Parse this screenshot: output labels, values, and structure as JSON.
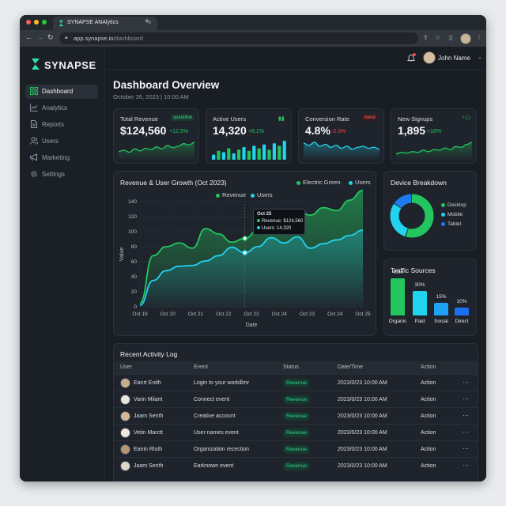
{
  "browser": {
    "tab_title": "SYNAPSE ANAlytics",
    "url_domain": "app.synapse.io",
    "url_path": "/dashboard",
    "new_tab": "+",
    "tab_close": "×"
  },
  "sidebar": {
    "brand": "SYNAPSE",
    "items": [
      {
        "label": "Dashboard",
        "icon": "grid-icon",
        "active": true
      },
      {
        "label": "Analytics",
        "icon": "chart-line-icon",
        "active": false
      },
      {
        "label": "Reports",
        "icon": "file-icon",
        "active": false
      },
      {
        "label": "Users",
        "icon": "users-icon",
        "active": false
      },
      {
        "label": "Marketing",
        "icon": "megaphone-icon",
        "active": false
      },
      {
        "label": "Settings",
        "icon": "gear-icon",
        "active": false
      }
    ]
  },
  "header": {
    "user_name": "John Name",
    "title": "Dashboard Overview",
    "date": "October 26, 2023 | 10:00 AM"
  },
  "kpis": [
    {
      "label": "Total Revenue",
      "value": "$124,560",
      "change": "+12.5%",
      "badge": "sparkline",
      "color": "#22c55e"
    },
    {
      "label": "Active Users",
      "value": "14,320",
      "change": "+8.1%",
      "badge": "",
      "color": "#22c55e"
    },
    {
      "label": "Conversion Rate",
      "value": "4.8%",
      "change": "-2.3%",
      "badge": "trend",
      "color": "#ef4444"
    },
    {
      "label": "New Signups",
      "value": "1,895",
      "change": "+18%",
      "badge": "",
      "color": "#22c55e"
    }
  ],
  "revenue_chart": {
    "title": "Revenue & User Growth (Oct 2023)",
    "header_legend": [
      "Electric Green",
      "Users"
    ],
    "legend": [
      "Revenue",
      "Users"
    ],
    "tooltip": {
      "date": "Oct 25",
      "revenue": "Revenue: $124,560",
      "users": "Users: 14,320"
    }
  },
  "device_chart": {
    "title": "Device Breakdown",
    "legend": [
      "Desktop",
      "Mobile",
      "Tablet"
    ]
  },
  "traffic": {
    "title": "Traffic Sources"
  },
  "chart_data": [
    {
      "type": "area",
      "title": "Revenue & User Growth (Oct 2023)",
      "xlabel": "Date",
      "ylabel": "Value",
      "categories": [
        "Oct 19",
        "Oct 20",
        "Oct 21",
        "Oct 22",
        "Oct 23",
        "Oct 24",
        "Oct 23",
        "Oct 24",
        "Oct 25"
      ],
      "ylim": [
        0,
        140
      ],
      "yticks": [
        0,
        20,
        40,
        60,
        80,
        100,
        120,
        140
      ],
      "series": [
        {
          "name": "Revenue",
          "color": "#22c55e",
          "values": [
            5,
            68,
            80,
            85,
            78,
            104,
            97,
            86,
            91,
            102,
            108,
            118,
            128,
            122,
            132,
            128,
            142,
            155
          ]
        },
        {
          "name": "Users",
          "color": "#22d3ee",
          "values": [
            2,
            35,
            48,
            54,
            55,
            61,
            68,
            79,
            72,
            80,
            92,
            85,
            93,
            78,
            84,
            89,
            95,
            102
          ]
        }
      ],
      "grid": true,
      "legend_position": "top"
    },
    {
      "type": "pie",
      "title": "Device Breakdown",
      "labels": [
        "Desktop",
        "Mobile",
        "Tablet"
      ],
      "values": [
        55,
        30,
        15
      ],
      "colors": [
        "#22c55e",
        "#22d3ee",
        "#1d7bf2"
      ]
    },
    {
      "type": "bar",
      "title": "Traffic Sources",
      "categories": [
        "Organic",
        "Paid",
        "Social",
        "Direct"
      ],
      "values": [
        45,
        30,
        15,
        10
      ],
      "labels": [
        "45%",
        "30%",
        "15%",
        "10%"
      ],
      "colors": [
        "#22c55e",
        "#22d3ee",
        "#1fa2f5",
        "#1d6ff2"
      ]
    }
  ],
  "kpi_sparks": [
    [
      10,
      12,
      9,
      14,
      11,
      15,
      13,
      17,
      14,
      19,
      16,
      18,
      22,
      20,
      24
    ],
    [
      4,
      7,
      6,
      9,
      5,
      8,
      10,
      7,
      11,
      9,
      12,
      8,
      13,
      11,
      15
    ],
    [
      15,
      13,
      16,
      12,
      14,
      11,
      13,
      10,
      12,
      9,
      11,
      12,
      10,
      11,
      9
    ],
    [
      6,
      8,
      7,
      9,
      8,
      11,
      9,
      12,
      11,
      14,
      12,
      16,
      15,
      19,
      22
    ]
  ],
  "activity": {
    "title": "Recent Activity Log",
    "columns": [
      "User",
      "Event",
      "Status",
      "Date/Time",
      "Action"
    ],
    "rows": [
      {
        "user": "Eanrt Enith",
        "event": "Login to your workillmr",
        "status": "Revenue",
        "datetime": "2023/0/23 10:00 AM",
        "action": "Action"
      },
      {
        "user": "Varin Miiant",
        "event": "Connect event",
        "status": "Revenue",
        "datetime": "2023/0/23 10:00 AM",
        "action": "Action"
      },
      {
        "user": "Jaam Senth",
        "event": "Creative account",
        "status": "Revenue",
        "datetime": "2023/0/23 10:00 AM",
        "action": "Action"
      },
      {
        "user": "Vetin Marctt",
        "event": "User names event",
        "status": "Revenue",
        "datetime": "2023/0/23 10:00 AM",
        "action": "Action"
      },
      {
        "user": "Eanin Rluth",
        "event": "Organization recection",
        "status": "Revenue",
        "datetime": "2023/0/23 10:00 AM",
        "action": "Action"
      },
      {
        "user": "Jaam Senth",
        "event": "Earknown event",
        "status": "Revenue",
        "datetime": "2023/0/23 10:00 AM",
        "action": "Action"
      }
    ]
  }
}
